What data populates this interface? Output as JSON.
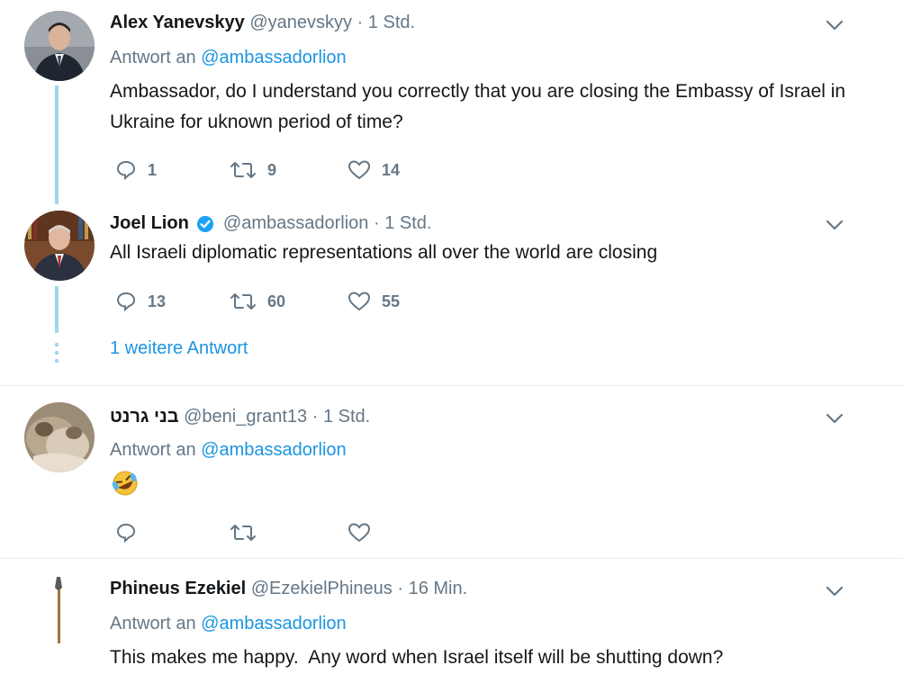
{
  "tweets": [
    {
      "name": "Alex Yanevskyy",
      "handle": "@yanevskyy",
      "dot": "·",
      "time": "1 Std.",
      "reply_prefix": "Antwort an",
      "reply_handle": "@ambassadorlion",
      "text": "Ambassador, do I understand you correctly that you are closing the Embassy of Israel in Ukraine for uknown period of time?",
      "replies": "1",
      "retweets": "9",
      "likes": "14"
    },
    {
      "name": "Joel Lion",
      "handle": "@ambassadorlion",
      "dot": "·",
      "time": "1 Std.",
      "text": "All Israeli diplomatic representations all over the world are closing",
      "replies": "13",
      "retweets": "60",
      "likes": "55",
      "verified": true
    },
    {
      "name": "בני גרנט",
      "handle": "@beni_grant13",
      "dot": "·",
      "time": "1 Std.",
      "reply_prefix": "Antwort an",
      "reply_handle": "@ambassadorlion",
      "text": "🤣",
      "replies": "",
      "retweets": "",
      "likes": ""
    },
    {
      "name": "Phineus Ezekiel",
      "handle": "@EzekielPhineus",
      "dot": "·",
      "time": "16 Min.",
      "reply_prefix": "Antwort an",
      "reply_handle": "@ambassadorlion",
      "text": "This makes me happy.  Any word when Israel itself will be shutting down?"
    }
  ],
  "more_replies": "1 weitere Antwort",
  "colors": {
    "link": "#1b95e0",
    "muted": "#657786",
    "thread": "#9ed6ec",
    "verified": "#1da1f2"
  }
}
